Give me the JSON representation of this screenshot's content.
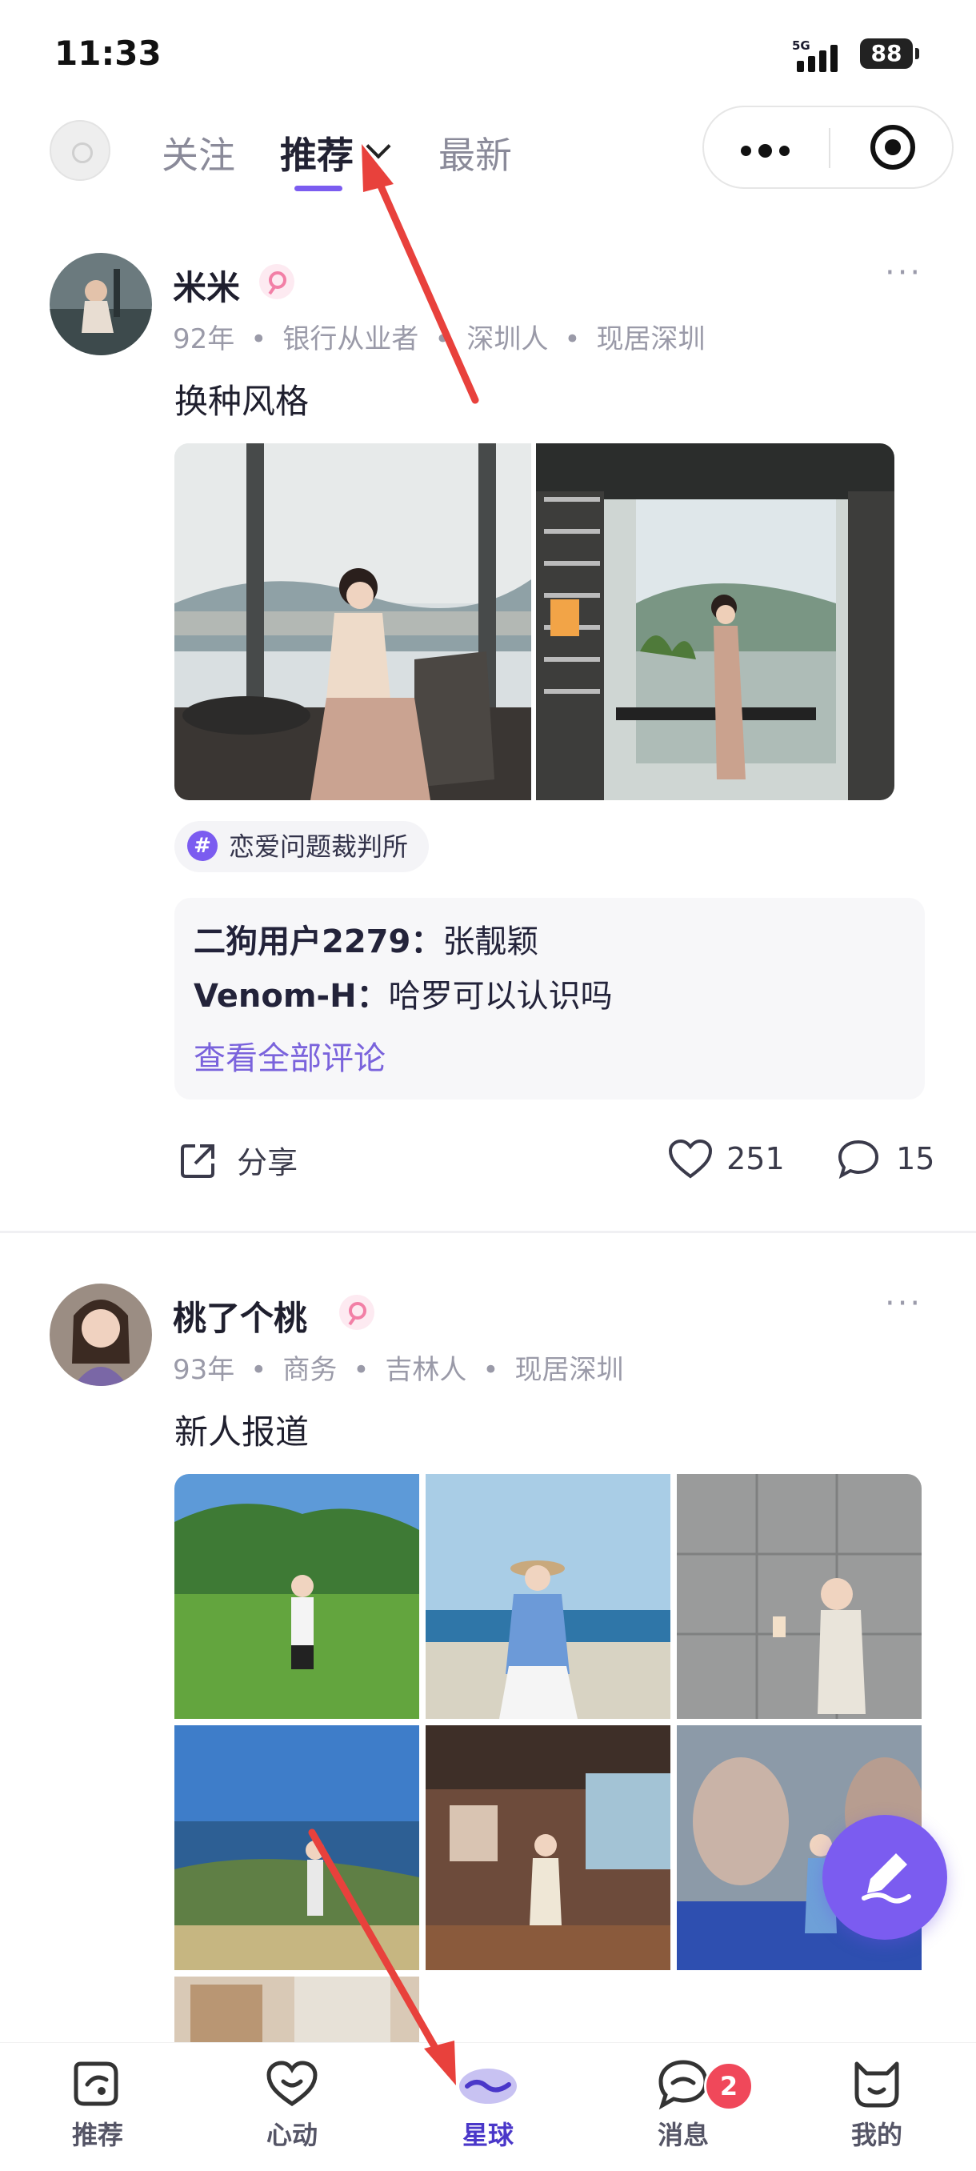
{
  "status_bar": {
    "time": "11:33",
    "network": "5G",
    "battery": "88"
  },
  "top_nav": {
    "tabs": [
      {
        "label": "关注",
        "active": false
      },
      {
        "label": "推荐",
        "active": true
      },
      {
        "label": "最新",
        "active": false
      }
    ]
  },
  "posts": [
    {
      "username": "米米",
      "meta": [
        "92年",
        "银行从业者",
        "深圳人",
        "现居深圳"
      ],
      "text": "换种风格",
      "topic": "恋爱问题裁判所",
      "comments": [
        {
          "user": "二狗用户2279：",
          "text": "张靓颖"
        },
        {
          "user": "Venom-H：",
          "text": "哈罗可以认识吗"
        }
      ],
      "view_all": "查看全部评论",
      "share_label": "分享",
      "likes": "251",
      "comments_count": "15"
    },
    {
      "username": "桃了个桃",
      "meta": [
        "93年",
        "商务",
        "吉林人",
        "现居深圳"
      ],
      "text": "新人报道"
    }
  ],
  "bottom_tabs": [
    {
      "label": "推荐",
      "icon": "recommend-icon"
    },
    {
      "label": "心动",
      "icon": "heart-face-icon"
    },
    {
      "label": "星球",
      "icon": "planet-icon",
      "active": true
    },
    {
      "label": "消息",
      "icon": "message-icon",
      "badge": "2"
    },
    {
      "label": "我的",
      "icon": "cat-profile-icon"
    }
  ],
  "colors": {
    "accent": "#7b5cf0",
    "badge": "#f0485a",
    "arrow": "#e8413c"
  }
}
